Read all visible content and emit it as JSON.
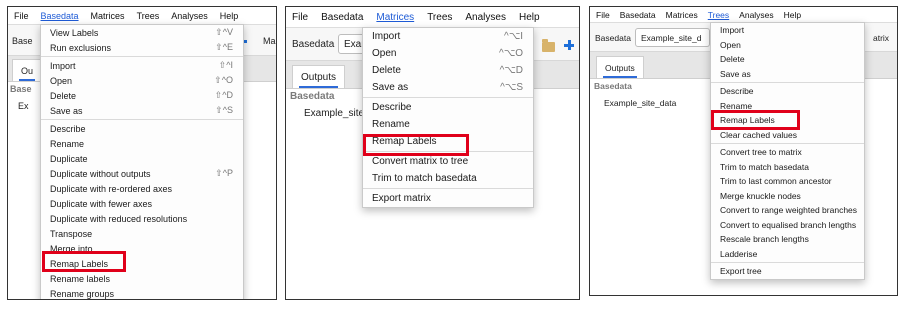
{
  "panel1": {
    "menubar": [
      "File",
      "Basedata",
      "Matrices",
      "Trees",
      "Analyses",
      "Help"
    ],
    "active_menu": "Basedata",
    "toolbar_label": "Base",
    "toolbar_label_right": "Ma",
    "tab_label": "Ou",
    "list_header": "Base",
    "list_item": "Ex",
    "menu_items": [
      {
        "label": "View Labels",
        "shortcut": "⇧^V"
      },
      {
        "label": "Run exclusions",
        "shortcut": "⇧^E"
      },
      {
        "label": "Import",
        "shortcut": "⇧^I"
      },
      {
        "label": "Open",
        "shortcut": "⇧^O"
      },
      {
        "label": "Delete",
        "shortcut": "⇧^D"
      },
      {
        "label": "Save as",
        "shortcut": "⇧^S"
      },
      {
        "label": "Describe",
        "shortcut": ""
      },
      {
        "label": "Rename",
        "shortcut": ""
      },
      {
        "label": "Duplicate",
        "shortcut": ""
      },
      {
        "label": "Duplicate without outputs",
        "shortcut": "⇧^P"
      },
      {
        "label": "Duplicate with re-ordered axes",
        "shortcut": ""
      },
      {
        "label": "Duplicate with fewer axes",
        "shortcut": ""
      },
      {
        "label": "Duplicate with reduced resolutions",
        "shortcut": ""
      },
      {
        "label": "Transpose",
        "shortcut": ""
      },
      {
        "label": "Merge into",
        "shortcut": ""
      },
      {
        "label": "Remap Labels",
        "shortcut": ""
      },
      {
        "label": "Rename labels",
        "shortcut": ""
      },
      {
        "label": "Rename groups",
        "shortcut": ""
      }
    ]
  },
  "panel2": {
    "menubar": [
      "File",
      "Basedata",
      "Matrices",
      "Trees",
      "Analyses",
      "Help"
    ],
    "active_menu": "Matrices",
    "toolbar_label": "Basedata",
    "combo_value": "Exan",
    "tab_label": "Outputs",
    "list_header": "Basedata",
    "list_item": "Example_site_",
    "menu_items": [
      {
        "label": "Import",
        "shortcut": "^⌥I"
      },
      {
        "label": "Open",
        "shortcut": "^⌥O"
      },
      {
        "label": "Delete",
        "shortcut": "^⌥D"
      },
      {
        "label": "Save as",
        "shortcut": "^⌥S"
      },
      {
        "label": "Describe",
        "shortcut": ""
      },
      {
        "label": "Rename",
        "shortcut": ""
      },
      {
        "label": "Remap Labels",
        "shortcut": ""
      },
      {
        "label": "Convert matrix to tree",
        "shortcut": ""
      },
      {
        "label": "Trim to match basedata",
        "shortcut": ""
      },
      {
        "label": "Export matrix",
        "shortcut": ""
      }
    ]
  },
  "panel3": {
    "menubar": [
      "File",
      "Basedata",
      "Matrices",
      "Trees",
      "Analyses",
      "Help"
    ],
    "active_menu": "Trees",
    "toolbar_label": "Basedata",
    "combo_value": "Example_site_d",
    "toolbar_right": "atrix",
    "tab_label": "Outputs",
    "list_header": "Basedata",
    "list_item": "Example_site_data",
    "menu_items": [
      {
        "label": "Import",
        "shortcut": ""
      },
      {
        "label": "Open",
        "shortcut": ""
      },
      {
        "label": "Delete",
        "shortcut": ""
      },
      {
        "label": "Save as",
        "shortcut": ""
      },
      {
        "label": "Describe",
        "shortcut": ""
      },
      {
        "label": "Rename",
        "shortcut": ""
      },
      {
        "label": "Remap Labels",
        "shortcut": ""
      },
      {
        "label": "Clear cached values",
        "shortcut": ""
      },
      {
        "label": "Convert tree to matrix",
        "shortcut": ""
      },
      {
        "label": "Trim to match basedata",
        "shortcut": ""
      },
      {
        "label": "Trim to last common ancestor",
        "shortcut": ""
      },
      {
        "label": "Merge knuckle nodes",
        "shortcut": ""
      },
      {
        "label": "Convert to range weighted branches",
        "shortcut": ""
      },
      {
        "label": "Convert to equalised branch lengths",
        "shortcut": ""
      },
      {
        "label": "Rescale branch lengths",
        "shortcut": ""
      },
      {
        "label": "Ladderise",
        "shortcut": ""
      },
      {
        "label": "Export tree",
        "shortcut": ""
      }
    ]
  },
  "colors": {
    "highlight_box": "#e0001a",
    "active_menu": "#1e5bd6",
    "add_icon": "#1e6fd9"
  },
  "icons": [
    "add-icon",
    "folder-icon"
  ]
}
